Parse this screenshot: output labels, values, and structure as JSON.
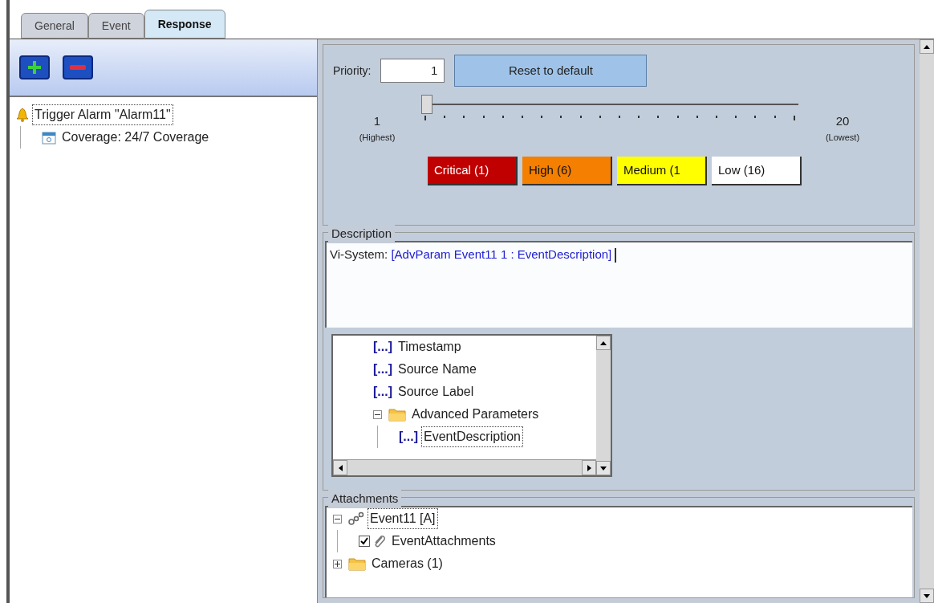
{
  "tabs": [
    {
      "label": "General",
      "selected": false
    },
    {
      "label": "Event",
      "selected": false
    },
    {
      "label": "Response",
      "selected": true
    }
  ],
  "response_tree": [
    {
      "label": "Trigger Alarm \"Alarm11\"",
      "kind": "alarm",
      "selected": true,
      "children": [
        {
          "label": "Coverage: 24/7 Coverage",
          "kind": "calendar",
          "selected": false
        }
      ]
    }
  ],
  "priority": {
    "label": "Priority:",
    "value": "1",
    "reset_button": "Reset to default",
    "slider": {
      "level": 0,
      "min_label": "1",
      "min_caption": "(Highest)",
      "max_label": "20",
      "max_caption": "(Lowest)"
    },
    "levels": [
      {
        "label": "Critical (1)",
        "color": "#c00000"
      },
      {
        "label": "High (6)",
        "color": "#f47f00"
      },
      {
        "label": "Medium (1",
        "color": "#ffff00"
      },
      {
        "label": "Low (16)",
        "color": "#ffffff"
      }
    ]
  },
  "description": {
    "title": "Description",
    "prefix": "Vi-System:",
    "parameter": "[AdvParam Event11 1 : EventDescription]",
    "parameters": [
      {
        "label": "Timestamp",
        "kind": "param",
        "selected": false
      },
      {
        "label": "Source Name",
        "kind": "param",
        "selected": false
      },
      {
        "label": "Source Label",
        "kind": "param",
        "selected": false
      },
      {
        "label": "Advanced Parameters",
        "kind": "folder",
        "expanded": true,
        "selected": false,
        "children": [
          {
            "label": "EventDescription",
            "kind": "param",
            "selected": true
          }
        ]
      }
    ],
    "param_marker": "[...]"
  },
  "attachments": {
    "title": "Attachments",
    "tree": [
      {
        "label": "Event11 [A]",
        "kind": "event",
        "expanded": true,
        "selected": true,
        "children": [
          {
            "label": "EventAttachments",
            "kind": "attachment",
            "checked": true,
            "selected": false
          }
        ]
      },
      {
        "label": "Cameras (1)",
        "kind": "folder",
        "expanded": false,
        "selected": false
      }
    ]
  }
}
